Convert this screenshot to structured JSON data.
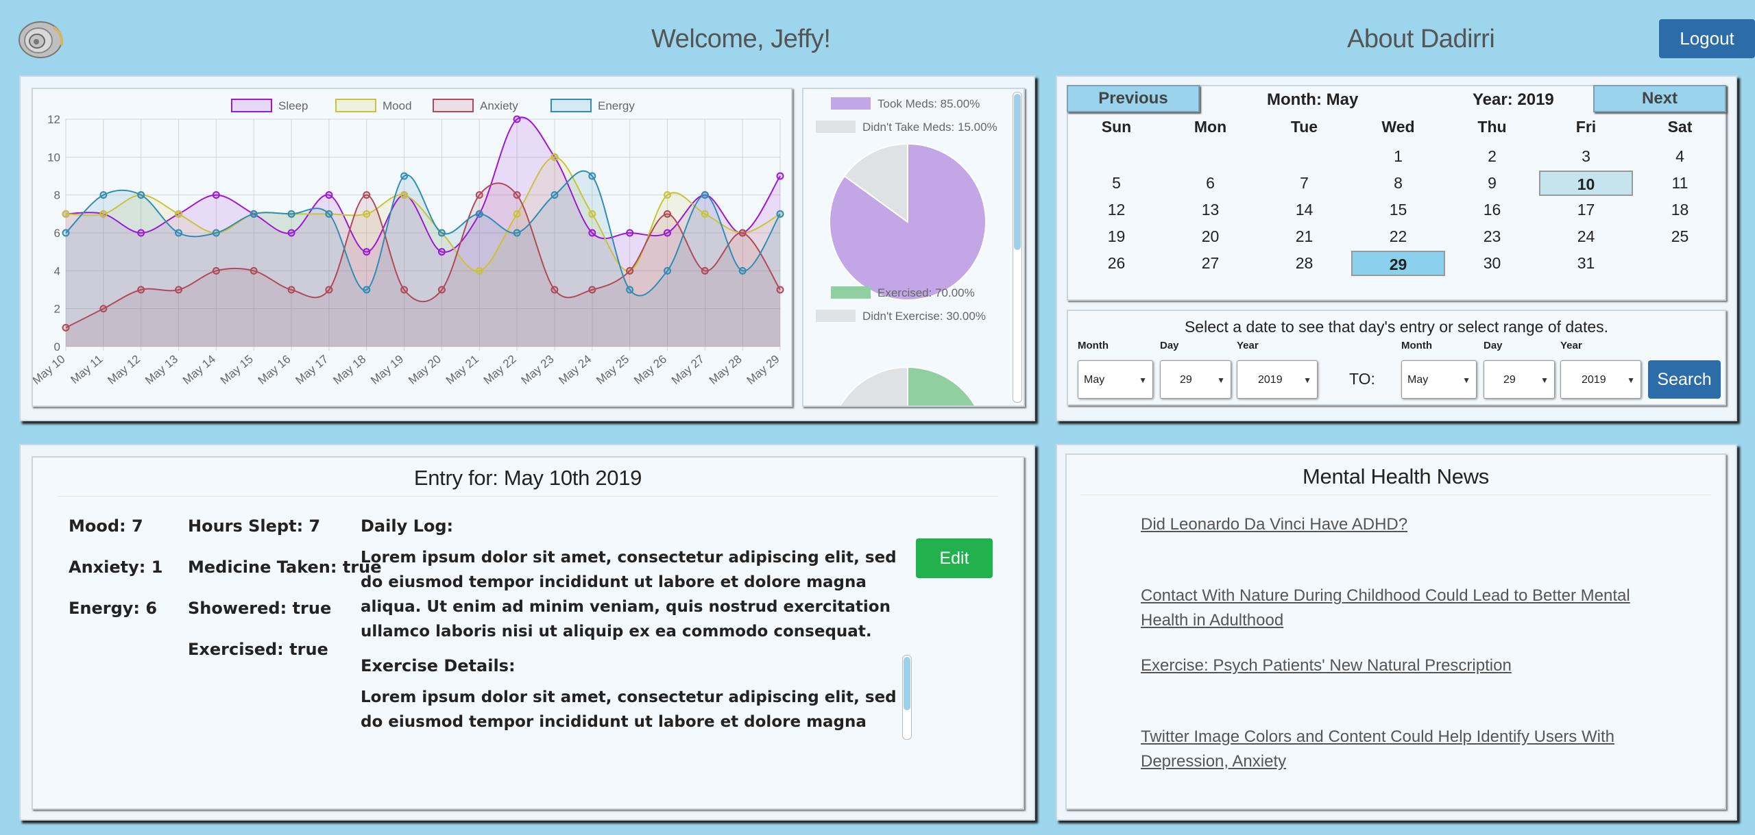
{
  "header": {
    "welcome": "Welcome, Jeffy!",
    "about": "About Dadirri",
    "logout_label": "Logout"
  },
  "chart_data": [
    {
      "type": "line",
      "x": [
        "May 10",
        "May 11",
        "May 12",
        "May 13",
        "May 14",
        "May 15",
        "May 16",
        "May 17",
        "May 18",
        "May 19",
        "May 20",
        "May 21",
        "May 22",
        "May 23",
        "May 24",
        "May 25",
        "May 26",
        "May 27",
        "May 28",
        "May 29"
      ],
      "series": [
        {
          "name": "Sleep",
          "color": "#9b19d6",
          "values": [
            7,
            7,
            6,
            7,
            8,
            7,
            6,
            8,
            5,
            8,
            5,
            7,
            12,
            10,
            6,
            6,
            6,
            8,
            6,
            9
          ]
        },
        {
          "name": "Mood",
          "color": "#c9c435",
          "values": [
            7,
            7,
            8,
            7,
            6,
            7,
            7,
            7,
            7,
            8,
            6,
            4,
            7,
            10,
            7,
            4,
            8,
            7,
            6,
            7
          ]
        },
        {
          "name": "Anxiety",
          "color": "#b04a5a",
          "values": [
            1,
            2,
            3,
            3,
            4,
            4,
            3,
            3,
            8,
            3,
            3,
            8,
            8,
            3,
            3,
            4,
            7,
            4,
            6,
            3
          ]
        },
        {
          "name": "Energy",
          "color": "#2f8db5",
          "values": [
            6,
            8,
            8,
            6,
            6,
            7,
            7,
            7,
            3,
            9,
            6,
            7,
            6,
            8,
            9,
            3,
            4,
            8,
            4,
            7
          ]
        }
      ],
      "ylim": [
        0,
        12
      ],
      "yticks": [
        "0",
        "2",
        "4",
        "6",
        "8",
        "10",
        "12"
      ],
      "legend": "top",
      "grid": true
    },
    {
      "type": "pie",
      "slices": [
        {
          "label": "Took Meds: 85.00%",
          "value": 85,
          "color": "#c3a6e6"
        },
        {
          "label": "Didn't Take Meds: 15.00%",
          "value": 15,
          "color": "#dfe2e5"
        }
      ]
    },
    {
      "type": "pie",
      "slices": [
        {
          "label": "Exercised: 70.00%",
          "value": 70,
          "color": "#8fcfa0"
        },
        {
          "label": "Didn't Exercise: 30.00%",
          "value": 30,
          "color": "#dfe2e5"
        }
      ]
    }
  ],
  "calendar": {
    "prev_label": "Previous",
    "next_label": "Next",
    "month_label": "Month: May",
    "year_label": "Year: 2019",
    "days_of_week": [
      "Sun",
      "Mon",
      "Tue",
      "Wed",
      "Thu",
      "Fri",
      "Sat"
    ],
    "first_weekday": 3,
    "days_in_month": 31,
    "selected_day": 10,
    "highlight_day": 29
  },
  "range": {
    "prompt": "Select a date to see that day's entry or select range of dates.",
    "month_label": "Month",
    "day_label": "Day",
    "year_label": "Year",
    "from_month": "May",
    "from_day": "29",
    "from_year": "2019",
    "to_label": "TO:",
    "to_month": "May",
    "to_day": "29",
    "to_year": "2019",
    "search_label": "Search"
  },
  "entry": {
    "title": "Entry for: May 10th 2019",
    "mood": "Mood: 7",
    "anxiety": "Anxiety: 1",
    "energy": "Energy: 6",
    "hours_slept": "Hours Slept: 7",
    "medicine": "Medicine Taken: true",
    "showered": "Showered: true",
    "exercised": "Exercised: true",
    "daily_log_heading": "Daily Log:",
    "daily_log": "Lorem ipsum dolor sit amet, consectetur adipiscing elit, sed do eiusmod tempor incididunt ut labore et dolore magna aliqua. Ut enim ad minim veniam, quis nostrud exercitation ullamco laboris nisi ut aliquip ex ea commodo consequat.",
    "exercise_heading": "Exercise Details:",
    "exercise_details": "Lorem ipsum dolor sit amet, consectetur adipiscing elit, sed do eiusmod tempor incididunt ut labore et dolore magna aliqua. Ut enim",
    "edit_label": "Edit"
  },
  "news": {
    "title": "Mental Health News",
    "items": [
      "Did Leonardo Da Vinci Have ADHD?",
      "Contact With Nature During Childhood Could Lead to Better Mental Health in Adulthood",
      "Exercise: Psych Patients' New Natural Prescription",
      "Twitter Image Colors and Content Could Help Identify Users With Depression, Anxiety"
    ]
  }
}
